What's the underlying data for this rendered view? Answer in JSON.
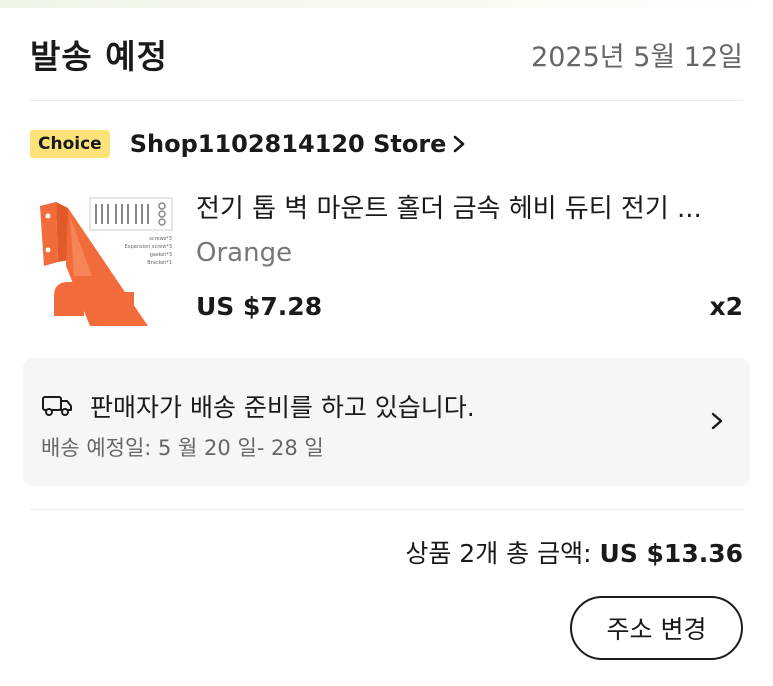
{
  "header": {
    "title": "발송 예정",
    "date": "2025년 5월 12일"
  },
  "store": {
    "badge": "Choice",
    "name": "Shop1102814120 Store",
    "chevron_icon": "chevron-right-icon"
  },
  "product": {
    "title": "전기 톱 벽 마운트 홀더 금속 헤비 듀티 전기 ...",
    "variant": "Orange",
    "price": "US $7.28",
    "quantity": "x2",
    "image_labels": [
      "screws*3",
      "Expansion screw*3",
      "gasket*3",
      "Bracket*1"
    ],
    "image_color": "#f26b3a"
  },
  "shipping": {
    "icon": "delivery-truck-icon",
    "status": "판매자가 배송 준비를 하고 있습니다.",
    "eta": "배송 예정일: 5 월 20 일- 28 일"
  },
  "summary": {
    "label": "상품 2개 총 금액:",
    "amount": "US $13.36"
  },
  "actions": {
    "change_address": "주소 변경"
  },
  "colors": {
    "choice_badge": "#fde27a",
    "product_orange": "#f26b3a",
    "ship_box_bg": "#f6f6f6",
    "muted_text": "#666666"
  }
}
